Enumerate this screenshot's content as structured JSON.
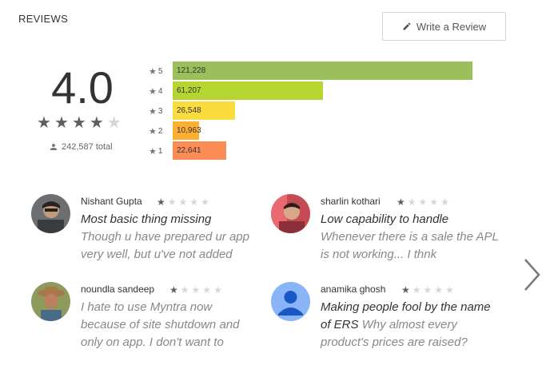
{
  "header": {
    "title": "REVIEWS",
    "write_review_label": "Write a Review"
  },
  "summary": {
    "score": "4.0",
    "stars": 4,
    "total": "242,587 total"
  },
  "histogram": [
    {
      "star": "5",
      "count": "121,228",
      "color": "#9bbf5a",
      "fraction": 1.0
    },
    {
      "star": "4",
      "count": "61,207",
      "color": "#b7d531",
      "fraction": 0.5
    },
    {
      "star": "3",
      "count": "26,548",
      "color": "#fcdb3e",
      "fraction": 0.208
    },
    {
      "star": "2",
      "count": "10,963",
      "color": "#fcaf31",
      "fraction": 0.088
    },
    {
      "star": "1",
      "count": "22,641",
      "color": "#fb8c55",
      "fraction": 0.179
    }
  ],
  "reviews": [
    {
      "name": "Nishant Gupta",
      "stars": 1,
      "title": "Most basic thing missing",
      "body": "Though u have prepared ur app very well, but u've not added"
    },
    {
      "name": "sharlin kothari",
      "stars": 1,
      "title": "Low capability to handle",
      "body": "Whenever there is a sale the APL is not working... I thnk"
    },
    {
      "name": "noundla sandeep",
      "stars": 1,
      "title": "",
      "body": "I hate to use Myntra now because of site shutdown and only on app. I don't want to"
    },
    {
      "name": "anamika ghosh",
      "stars": 1,
      "title": "Making people fool by the name of ERS",
      "body": "Why almost every product's prices are raised?"
    }
  ]
}
